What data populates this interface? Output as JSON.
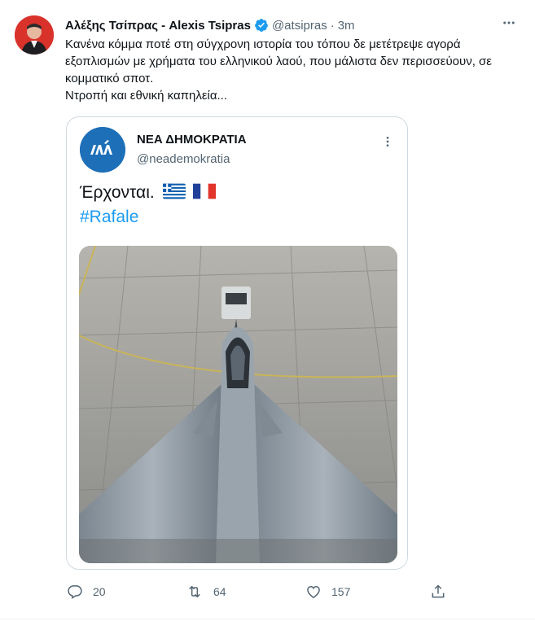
{
  "author": {
    "display_name": "Αλέξης Τσίπρας - Alexis Tsipras",
    "handle": "@atsipras",
    "separator": "·",
    "time": "3m",
    "avatar_icon": "profile-photo",
    "verified_icon": "verified-badge-icon"
  },
  "tweet": {
    "text": "Κανένα κόμμα ποτέ στη σύγχρονη ιστορία του τόπου δε μετέτρεψε αγορά εξοπλισμών με χρήματα του ελληνικού λαού, που μάλιστα δεν περισσεύουν, σε κομματικό σποτ.\nΝτροπή και εθνική καπηλεία..."
  },
  "quoted": {
    "display_name": "ΝΕΑ ΔΗΜΟΚΡΑΤΙΑ",
    "handle": "@neademokratia",
    "text_line1": "Έρχονται.",
    "hashtag": "#Rafale",
    "flags": [
      "greece-flag",
      "france-flag"
    ],
    "media": "Rafale fighter jet on airfield apron"
  },
  "actions": {
    "reply_count": "20",
    "retweet_count": "64",
    "like_count": "157",
    "share_label": ""
  },
  "colors": {
    "accent": "#1d9bf0",
    "secondary_text": "#536471",
    "border": "#cfd9de"
  }
}
